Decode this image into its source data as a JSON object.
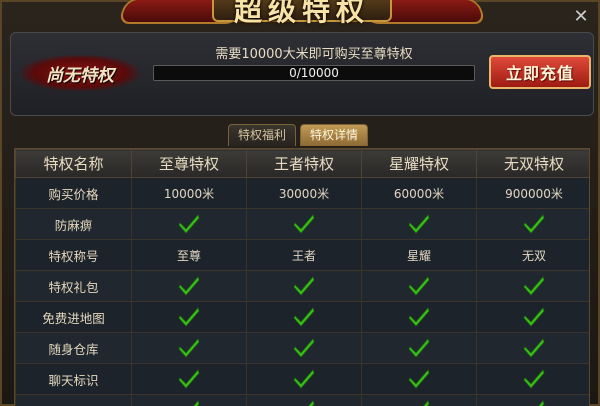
{
  "title": "超级特权",
  "header": {
    "status_badge": "尚无特权",
    "progress_text": "需要10000大米即可购买至尊特权",
    "progress_value": "0/10000",
    "progress_fraction": 0,
    "recharge_label": "立即充值"
  },
  "tabs": [
    {
      "label": "特权福利",
      "active": false
    },
    {
      "label": "特权详情",
      "active": true
    }
  ],
  "table": {
    "headers": [
      "特权名称",
      "至尊特权",
      "王者特权",
      "星耀特权",
      "无双特权"
    ],
    "rows": [
      {
        "name": "购买价格",
        "cells": [
          "10000米",
          "30000米",
          "60000米",
          "900000米"
        ]
      },
      {
        "name": "防麻痹",
        "cells": [
          "check",
          "check",
          "check",
          "check"
        ]
      },
      {
        "name": "特权称号",
        "cells": [
          "至尊",
          "王者",
          "星耀",
          "无双"
        ]
      },
      {
        "name": "特权礼包",
        "cells": [
          "check",
          "check",
          "check",
          "check"
        ]
      },
      {
        "name": "免费进地图",
        "cells": [
          "check",
          "check",
          "check",
          "check"
        ]
      },
      {
        "name": "随身仓库",
        "cells": [
          "check",
          "check",
          "check",
          "check"
        ]
      },
      {
        "name": "聊天标识",
        "cells": [
          "check",
          "check",
          "check",
          "check"
        ]
      },
      {
        "name": "",
        "cells": [
          "check",
          "check",
          "check",
          "check"
        ]
      }
    ]
  },
  "icons": {
    "check": "check-icon",
    "close": "close-icon"
  },
  "colors": {
    "accent": "#c8963c",
    "check": "#39c21a",
    "recharge": "#c8321f"
  }
}
